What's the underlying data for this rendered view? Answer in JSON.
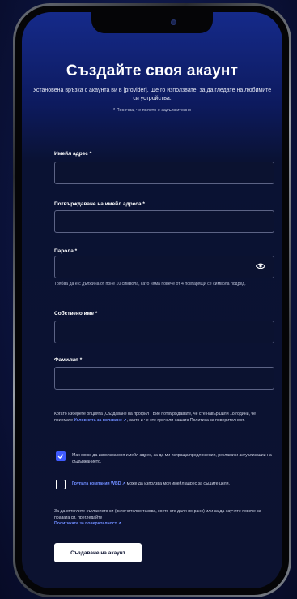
{
  "page": {
    "title": "Създайте своя акаунт",
    "subtitle": "Установена връзка с акаунта ви в [provider]. Ще го използвате, за да гледате на любимите си устройства.",
    "required_note": "* Посочва, че полето е задължително"
  },
  "form": {
    "email_label": "Имейл адрес *",
    "email_confirm_label": "Потвърждаване на имейл адреса *",
    "password_label": "Парола *",
    "password_hint": "Трябва да е с дължина от поне 10 символа, като няма повече от 4 повтарящи се символа подред.",
    "first_name_label": "Собствено име *",
    "last_name_label": "Фамилия *"
  },
  "legal": {
    "text_before": "Когато изберете опцията „Създаване на профил“, Вие потвърждавате, че сте навършили 18 години, че приемате ",
    "terms_link": "Условията за ползване ↗",
    "text_after": ", както и че сте прочели нашата Политика за поверителност."
  },
  "checkboxes": [
    {
      "checked": true,
      "text": "Max може да използва моя имейл адрес, за да ми изпраща предложения, реклами и актуализации на съдържанието."
    },
    {
      "checked": false,
      "link": "Групата компании WBD ↗",
      "text": " може да използва моя имейл адрес за същите цели."
    }
  ],
  "footer": {
    "text": "За да оттеглите съгласието си (включително такова, което сте дали по-рано) или за да научите повече за правата си, прегледайте",
    "privacy_link": "Политиката за поверителност ↗."
  },
  "submit_label": "Създаване на акаунт",
  "colors": {
    "accent": "#3f5bff",
    "link": "#6f8cff",
    "background": "#0c1230"
  }
}
